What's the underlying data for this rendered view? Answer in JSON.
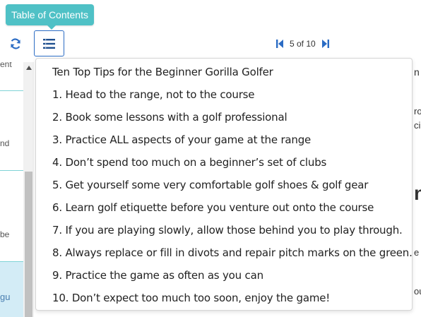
{
  "tooltip": {
    "text": "Table of Contents"
  },
  "toolbar": {
    "refresh_icon": "refresh-icon",
    "toc_icon": "list-icon",
    "pager": {
      "text": "5 of 10",
      "current": 5,
      "total": 10
    },
    "accent_color": "#2b6cc4"
  },
  "sidebar": {
    "items": [
      "ent",
      "nd",
      "be",
      "gu"
    ]
  },
  "content_fragments": [
    "n a",
    "ro",
    "cin",
    "n",
    "e",
    "ou"
  ],
  "toc": {
    "title": "Ten Top Tips for the Beginner Gorilla Golfer",
    "items": [
      "1. Head to the range, not to the course",
      "2. Book some lessons with a golf professional",
      "3. Practice ALL aspects of your game at the range",
      "4. Don’t spend too much on a beginner’s set of clubs",
      "5. Get yourself some very comfortable golf shoes & golf gear",
      "6. Learn golf etiquette before you venture out onto the course",
      "7. If you are playing slowly, allow those behind you to play through.",
      "8. Always replace or fill in divots and repair pitch marks on the green.",
      "9. Practice the game as often as you can",
      "10. Don’t expect too much too soon, enjoy the game!"
    ]
  },
  "colors": {
    "tooltip_bg": "#4fc1c6",
    "active_item_bg": "#d3ecf6",
    "divider": "#7fd3d6"
  }
}
